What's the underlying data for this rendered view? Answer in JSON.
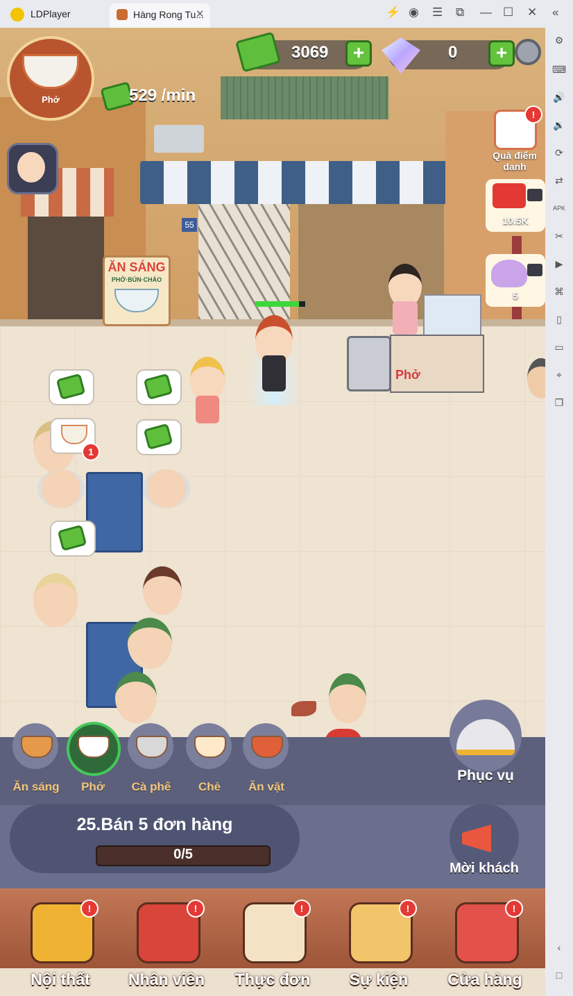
{
  "window": {
    "app_name": "LDPlayer",
    "tab_title": "Hàng Rong Tu...",
    "icons": [
      "bolt-icon",
      "account-icon",
      "menu-icon",
      "resize-icon",
      "minimize-icon",
      "maximize-icon",
      "close-icon",
      "collapse-icon"
    ]
  },
  "sidebar": {
    "icons": [
      "settings-icon",
      "keyboard-icon",
      "volume-up-icon",
      "volume-down-icon",
      "rotate-icon",
      "sync-icon",
      "apk-icon",
      "scissors-icon",
      "record-icon",
      "translate-icon",
      "shake-icon",
      "folder-icon",
      "location-icon",
      "multi-instance-icon",
      "back-icon",
      "home-icon"
    ]
  },
  "hud": {
    "shop_badge": "Phở",
    "cash": "3069",
    "gems": "0",
    "income_rate": "529 /min"
  },
  "side_panel": {
    "checkin_label": "Quà điểm danh",
    "red_envelope_value": "10.5K",
    "gift_bag_value": "5"
  },
  "scene": {
    "sign_title": "ĂN SÁNG",
    "sign_subtitle": "PHỞ·BÚN·CHÁO",
    "house_number": "55",
    "stall_label": "Phở",
    "order_badge": "1"
  },
  "categories": [
    {
      "label": "Ăn sáng",
      "icon": "sandwich-icon",
      "color": "#e49a4a"
    },
    {
      "label": "Phở",
      "icon": "pho-bowl-icon",
      "color": "#ffffff"
    },
    {
      "label": "Cà phê",
      "icon": "coffee-filter-icon",
      "color": "#d8d8d8"
    },
    {
      "label": "Chè",
      "icon": "che-bowl-icon",
      "color": "#ffe9c9"
    },
    {
      "label": "Ăn vặt",
      "icon": "skewer-icon",
      "color": "#e0603a"
    }
  ],
  "serve_label": "Phục vụ",
  "invite_label": "Mời khách",
  "quest": {
    "title": "25.Bán 5 đơn hàng",
    "progress_text": "0/5",
    "progress_fraction": 0
  },
  "nav": [
    {
      "label": "Nội thất",
      "icon": "shopping-cart-icon",
      "color": "#f0b232"
    },
    {
      "label": "Nhân viên",
      "icon": "staff-face-icon",
      "color": "#d9453a"
    },
    {
      "label": "Thực đơn",
      "icon": "menu-checklist-icon",
      "color": "#f3e3c4"
    },
    {
      "label": "Sự kiện",
      "icon": "event-box-icon",
      "color": "#f2c56b"
    },
    {
      "label": "Cửa hàng",
      "icon": "storefront-icon",
      "color": "#e2524a"
    }
  ],
  "colors": {
    "accent_gold": "#f2c77e",
    "money_green": "#5fbf3c",
    "badge_red": "#e53935"
  }
}
